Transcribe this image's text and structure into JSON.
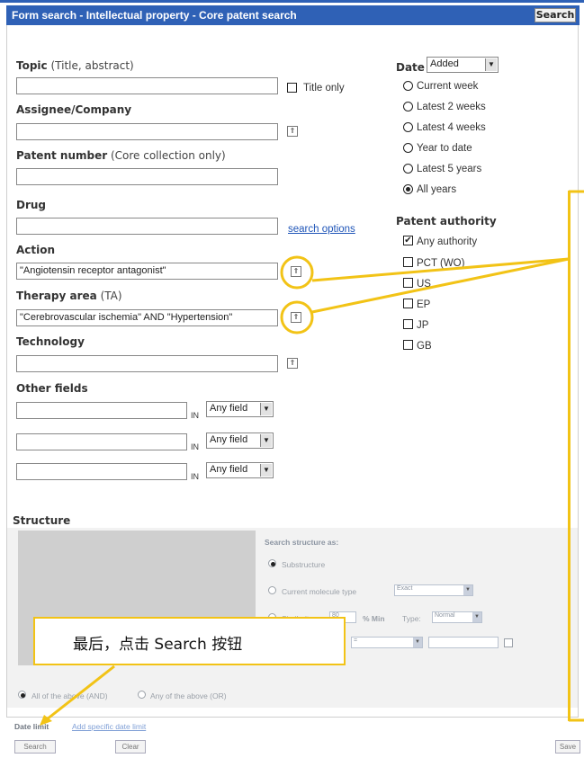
{
  "header": {
    "title": "Form search - Intellectual property - Core patent search",
    "search_button": "Search"
  },
  "topic": {
    "label": "Topic",
    "sub": "(Title, abstract)",
    "value": "",
    "title_only_label": "Title only"
  },
  "assignee": {
    "label": "Assignee/Company",
    "value": ""
  },
  "patent_number": {
    "label": "Patent number",
    "sub": "(Core collection only)",
    "value": ""
  },
  "drug": {
    "label": "Drug",
    "value": "",
    "search_options": "search options"
  },
  "action": {
    "label": "Action",
    "value": "\"Angiotensin receptor antagonist\""
  },
  "therapy": {
    "label": "Therapy area",
    "sub": "(TA)",
    "value": "\"Cerebrovascular ischemia\" AND \"Hypertension\""
  },
  "technology": {
    "label": "Technology",
    "value": ""
  },
  "other_fields": {
    "label": "Other fields",
    "in_label": "IN",
    "rows": [
      {
        "field": "Any field"
      },
      {
        "field": "Any field"
      },
      {
        "field": "Any field"
      }
    ]
  },
  "date": {
    "label": "Date",
    "select": "Added",
    "options": [
      "Current week",
      "Latest 2 weeks",
      "Latest 4 weeks",
      "Year to date",
      "Latest 5 years",
      "All years"
    ],
    "selected_index": 5
  },
  "authority": {
    "label": "Patent authority",
    "options": [
      "Any authority",
      "PCT (WO)",
      "US",
      "EP",
      "JP",
      "GB"
    ]
  },
  "structure": {
    "label": "Structure",
    "search_as": "Search structure as:",
    "substructure": "Substructure",
    "current_type": "Current molecule type",
    "current_type_value": "Exact",
    "similarity": "Similarity",
    "similarity_value": "80",
    "min_label": "% Min",
    "type_label": "Type:",
    "type_value": "Normal",
    "row4_value": "="
  },
  "combine": {
    "all": "All of the above (AND)",
    "any": "Any of the above (OR)"
  },
  "date_limit": {
    "label": "Date limit",
    "link": "Add specific date limit"
  },
  "footer": {
    "search": "Search",
    "clear": "Clear",
    "save": "Save"
  },
  "callout": {
    "text": "最后，点击 Search 按钮"
  },
  "colors": {
    "header": "#2f61b6",
    "highlight": "#f2c316",
    "link": "#1f55b8"
  }
}
